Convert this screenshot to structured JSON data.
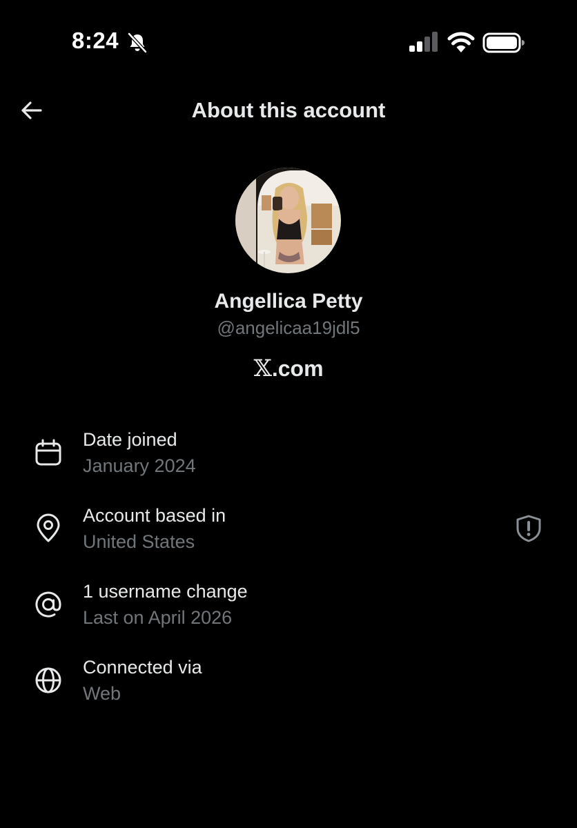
{
  "status_bar": {
    "time": "8:24",
    "icons": [
      "bell-muted-icon",
      "cellular-signal-icon",
      "wifi-icon",
      "battery-icon"
    ]
  },
  "header": {
    "title": "About this account",
    "back_icon": "arrow-left-icon"
  },
  "profile": {
    "avatar": "profile-photo",
    "display_name": "Angellica Petty",
    "handle": "@angelicaa19jdl5",
    "platform_mark": "𝕏",
    "platform_suffix": ".com"
  },
  "details": [
    {
      "icon": "calendar-icon",
      "label": "Date joined",
      "value": "January 2024"
    },
    {
      "icon": "location-pin-icon",
      "label": "Account based in",
      "value": "United States",
      "trailing_icon": "shield-alert-icon"
    },
    {
      "icon": "at-sign-icon",
      "label": "1 username change",
      "value": "Last on April 2026"
    },
    {
      "icon": "globe-icon",
      "label": "Connected via",
      "value": "Web"
    }
  ],
  "colors": {
    "background": "#000000",
    "primary_text": "#e7e9ea",
    "secondary_text": "#71767b"
  }
}
